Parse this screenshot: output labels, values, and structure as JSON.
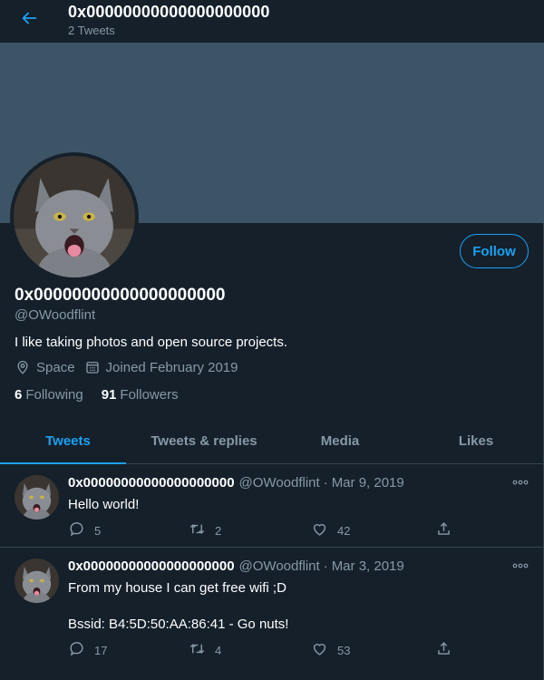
{
  "colors": {
    "background": "#15202b",
    "banner": "#3d5466",
    "accent": "#1da1f2",
    "muted": "#8899a6",
    "border": "#38444d"
  },
  "header": {
    "title": "0x00000000000000000000",
    "subtitle": "2 Tweets",
    "back_icon": "arrow-left-icon"
  },
  "profile": {
    "name": "0x00000000000000000000",
    "handle": "@OWoodflint",
    "bio": "I like taking photos and open source projects.",
    "location": "Space",
    "joined": "Joined February 2019",
    "following_count": "6",
    "following_label": "Following",
    "followers_count": "91",
    "followers_label": "Followers",
    "follow_label": "Follow",
    "icons": {
      "location": "location-pin-icon",
      "calendar": "calendar-icon",
      "avatar": "cat-avatar"
    }
  },
  "tabs": [
    {
      "label": "Tweets",
      "active": true
    },
    {
      "label": "Tweets & replies",
      "active": false
    },
    {
      "label": "Media",
      "active": false
    },
    {
      "label": "Likes",
      "active": false
    }
  ],
  "tweets": [
    {
      "name": "0x00000000000000000000",
      "handle": "@OWoodflint",
      "dot": "·",
      "date": "Mar 9, 2019",
      "lines": [
        "Hello world!"
      ],
      "replies": "5",
      "retweets": "2",
      "likes": "42"
    },
    {
      "name": "0x00000000000000000000",
      "handle": "@OWoodflint",
      "dot": "·",
      "date": "Mar 3, 2019",
      "lines": [
        "From my house I can get free wifi ;D",
        "",
        "Bssid: B4:5D:50:AA:86:41 - Go nuts!"
      ],
      "replies": "17",
      "retweets": "4",
      "likes": "53"
    }
  ]
}
